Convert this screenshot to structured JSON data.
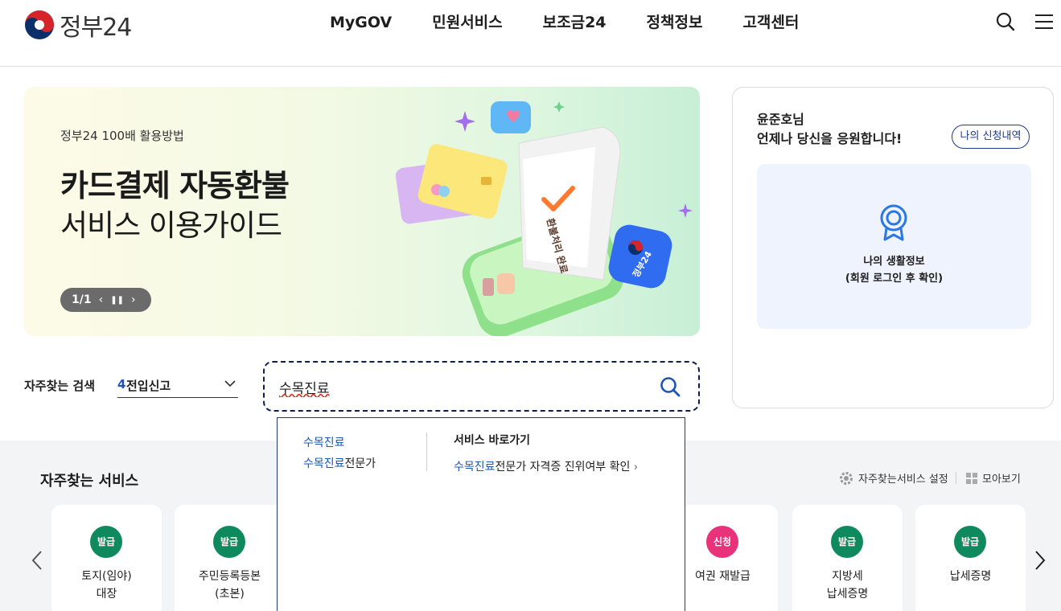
{
  "header": {
    "logo_text": "정부24",
    "nav": [
      "MyGOV",
      "민원서비스",
      "보조금24",
      "정책정보",
      "고객센터"
    ],
    "icons": [
      "search-icon",
      "menu-icon"
    ]
  },
  "banner": {
    "kicker": "정부24 100배 활용방법",
    "title": "카드결제 자동환불",
    "subtitle": "서비스 이용가이드",
    "pager": "1/1",
    "art_text": "환불처리 완료",
    "badge_text": "정부24"
  },
  "side": {
    "greeting_line1": "윤준호님",
    "greeting_line2": "언제나 당신을 응원합니다!",
    "apply_button": "나의 신청내역",
    "life_title": "나의 생활정보",
    "life_note": "(회원 로그인 후 확인)"
  },
  "search": {
    "label": "자주찾는 검색",
    "keyword_rank": "4",
    "keyword": "전입신고",
    "query": "수목진료"
  },
  "autocomplete": {
    "suggestions": [
      {
        "match": "수목진료",
        "rest": ""
      },
      {
        "match": "수목진료",
        "rest": "전문가"
      }
    ],
    "shortcut_heading": "서비스 바로가기",
    "shortcut": {
      "match": "수목진료",
      "rest": "전문가 자격증 진위여부 확인"
    }
  },
  "favorites": {
    "title": "자주찾는 서비스",
    "setting_label": "자주찾는서비스 설정",
    "view_all_label": "모아보기",
    "services": [
      {
        "badge": "발급",
        "name": "토지(임야)\n대장",
        "color": "#0f8a5f"
      },
      {
        "badge": "발급",
        "name": "주민등록등본\n(초본)",
        "color": "#0f8a5f"
      },
      {
        "badge": "신청",
        "name": "여권 재발급",
        "color": "#e8327a"
      },
      {
        "badge": "발급",
        "name": "지방세\n납세증명",
        "color": "#0f8a5f"
      },
      {
        "badge": "발급",
        "name": "납세증명",
        "color": "#0f8a5f"
      }
    ]
  },
  "colors": {
    "accent": "#1a56b8",
    "navy": "#1a3c8c",
    "issue_badge": "#0f8a5f",
    "apply_badge": "#e8327a"
  }
}
